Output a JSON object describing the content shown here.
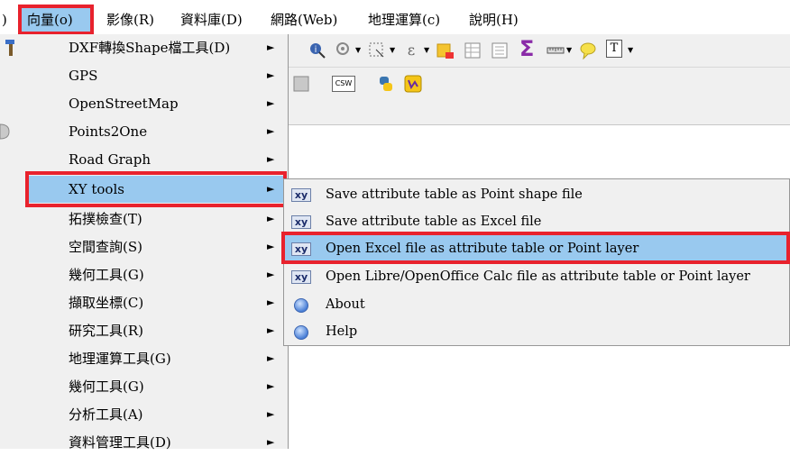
{
  "menubar": {
    "items": [
      ")",
      "向量(o)",
      "影像(R)",
      "資料庫(D)",
      "網路(Web)",
      "地理運算(c)",
      "說明(H)"
    ]
  },
  "vector_menu": {
    "items": [
      {
        "label": "DXF轉換Shape檔工具(D)",
        "submenu": true
      },
      {
        "label": "GPS",
        "submenu": true
      },
      {
        "label": "OpenStreetMap",
        "submenu": true
      },
      {
        "label": "Points2One",
        "submenu": true
      },
      {
        "label": "Road Graph",
        "submenu": true
      },
      {
        "label": "XY tools",
        "submenu": true,
        "selected": true
      },
      {
        "label": "拓撲檢查(T)",
        "submenu": true
      },
      {
        "label": "空間查詢(S)",
        "submenu": true
      },
      {
        "label": "幾何工具(G)",
        "submenu": true
      },
      {
        "label": "擷取坐標(C)",
        "submenu": true
      },
      {
        "label": "研究工具(R)",
        "submenu": true
      },
      {
        "label": "地理運算工具(G)",
        "submenu": true
      },
      {
        "label": "幾何工具(G)",
        "submenu": true
      },
      {
        "label": "分析工具(A)",
        "submenu": true
      },
      {
        "label": "資料管理工具(D)",
        "submenu": true
      }
    ],
    "arrow": "►"
  },
  "xy_submenu": {
    "items": [
      {
        "label": "Save attribute table as Point shape file",
        "icon": "xy-icon",
        "icon_text": "xy"
      },
      {
        "label": "Save attribute table as Excel file",
        "icon": "xy-icon",
        "icon_text": "xy"
      },
      {
        "label": "Open Excel file as attribute table or Point layer",
        "icon": "xy-icon",
        "icon_text": "xy",
        "selected": true
      },
      {
        "label": "Open Libre/OpenOffice Calc file as attribute table or Point layer",
        "icon": "xy-icon",
        "icon_text": "xy"
      },
      {
        "label": "About",
        "icon": "info-icon"
      },
      {
        "label": "Help",
        "icon": "info-icon"
      }
    ]
  },
  "toolbar": {
    "csw_label": "CSW",
    "sigma": "Σ",
    "text_tool": "T"
  },
  "colors": {
    "highlight": "#99c9ef",
    "annotation_border": "#e8222d",
    "menu_bg": "#f0f0f0"
  }
}
